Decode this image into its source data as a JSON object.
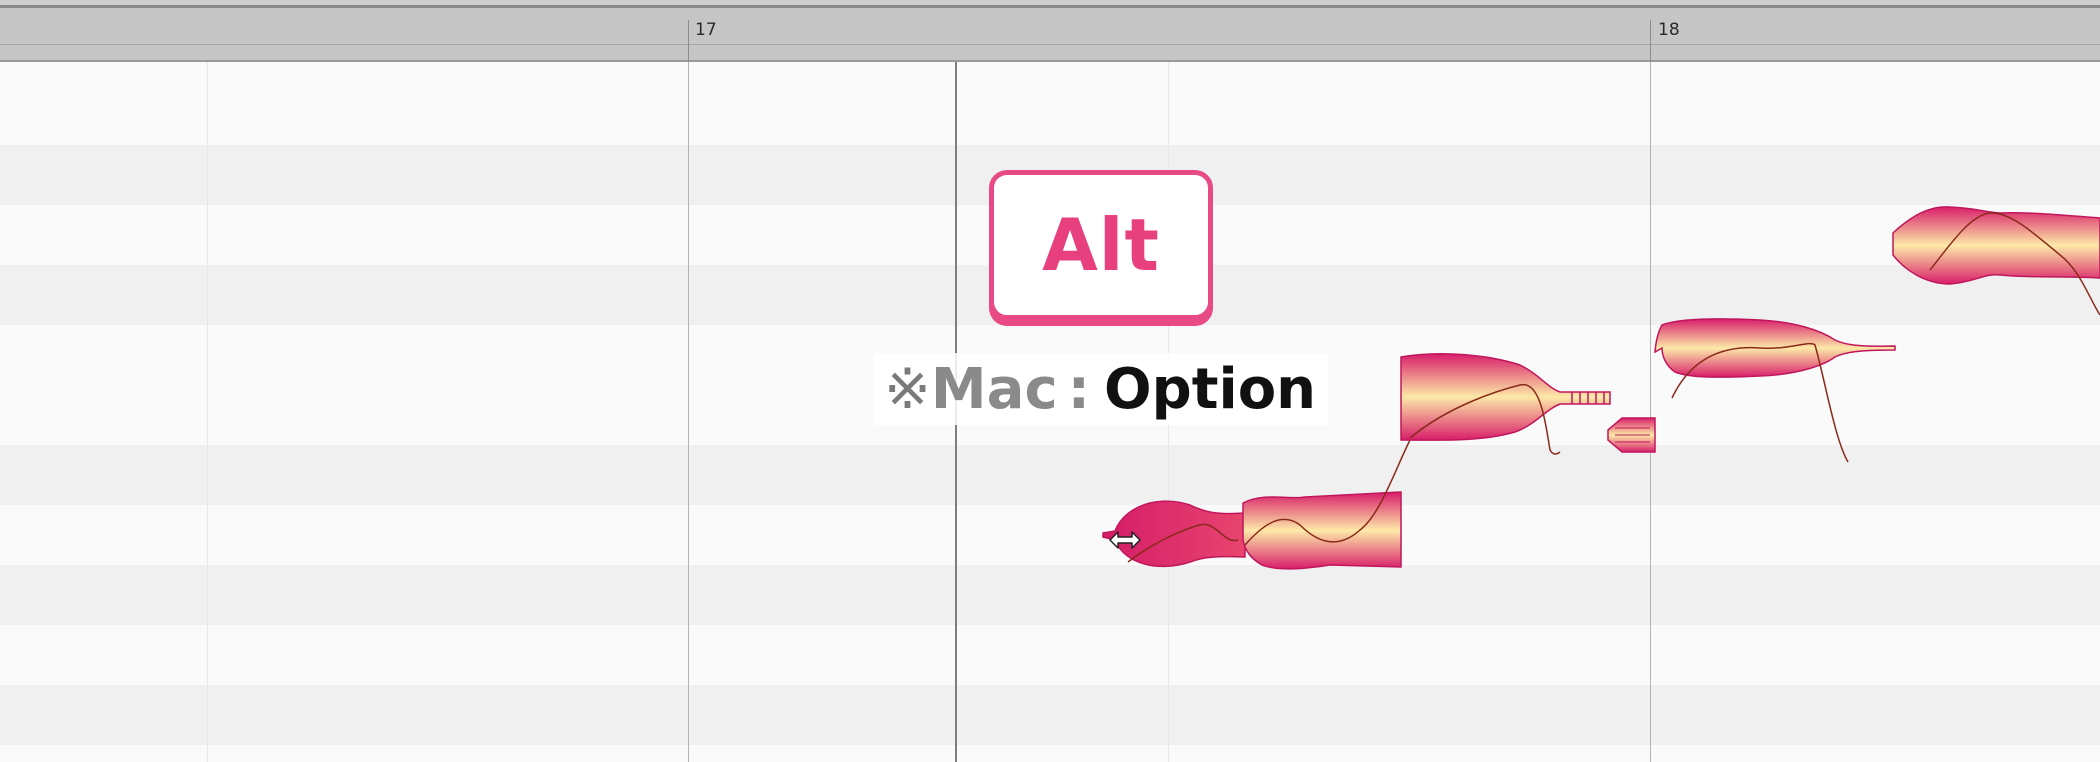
{
  "ruler": {
    "bars": [
      {
        "label": "17"
      },
      {
        "label": "18"
      }
    ]
  },
  "overlay": {
    "key_label": "Alt",
    "note_ref": "※",
    "note_platform": "Mac",
    "note_sep": ":",
    "note_key": "Option"
  },
  "colors": {
    "accent": "#e84a86",
    "blob_dark": "#d81e6a",
    "blob_light": "#fde9a8",
    "ruler_bg": "#c6c6c6"
  },
  "editor": {
    "tool_icon": "move-cursor-icon",
    "notes": [
      "note-blob-1",
      "note-blob-2",
      "note-blob-3",
      "note-blob-4",
      "note-blob-5",
      "note-blob-6"
    ]
  }
}
